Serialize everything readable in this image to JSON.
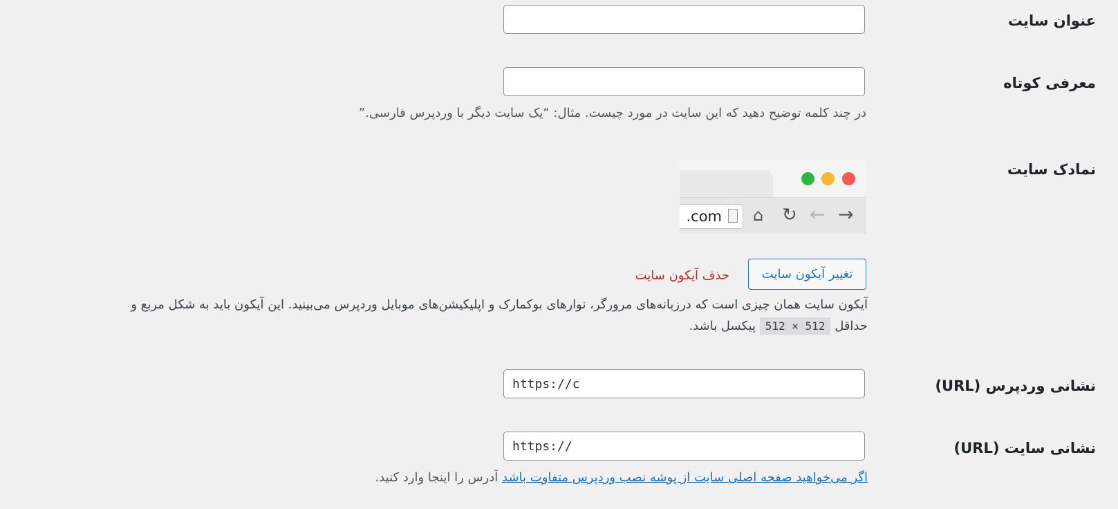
{
  "site_title": {
    "label": "عنوان سایت",
    "value": ""
  },
  "tagline": {
    "label": "معرفی کوتاه",
    "value": "",
    "description": "در چند کلمه توضیح دهید که این سایت در مورد چیست. مثال: “یک سایت دیگر با وردپرس فارسی.”"
  },
  "site_icon": {
    "label": "نمادک سایت",
    "preview_url_text": ".com",
    "change_button": "تغییر آیکون سایت",
    "remove_button": "حذف آیکون سایت",
    "description_line1": "آیکون سایت همان چیزی است که درزبانه‌های مرورگر، نوارهای بوکمارک و اپلیکیشن‌های موبایل وردپرس می‌بینید. این آیکون باید به شکل مربع و",
    "description_line2_before": "حداقل",
    "size_code": "512 × 512",
    "description_line2_after": "پیکسل باشد."
  },
  "wordpress_url": {
    "label": "نشانی وردپرس (URL)",
    "value": "https://c"
  },
  "site_url": {
    "label": "نشانی سایت (URL)",
    "value": "https://",
    "link_text": "اگر می‌خواهید صفحه اصلی سایت از پوشه نصب وردپرس متفاوت باشد",
    "description_after": " آدرس را اینجا وارد کنید."
  },
  "colors": {
    "background": "#f0f0f1",
    "link": "#2271b1",
    "delete": "#b32d2e",
    "traffic_green": "#2ab640",
    "traffic_yellow": "#f5b731",
    "traffic_red": "#f05a55"
  },
  "icons": [
    "document-icon",
    "home-icon",
    "reload-icon",
    "back-arrow-icon",
    "forward-arrow-icon",
    "traffic-light-icons"
  ]
}
